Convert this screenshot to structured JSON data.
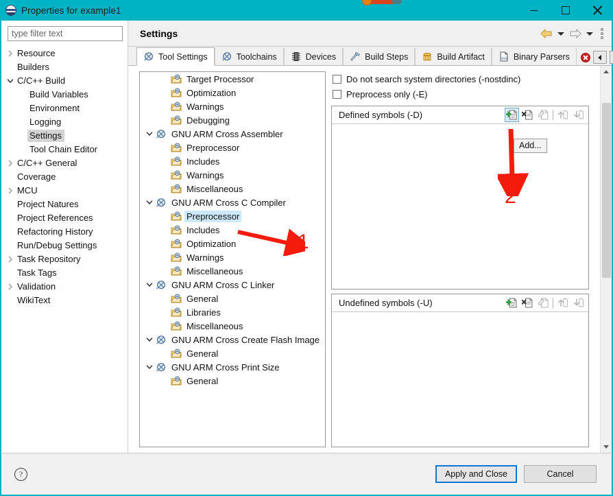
{
  "window": {
    "title": "Properties for example1",
    "app_icon": "eclipse-icon",
    "minimize_label": "Minimize",
    "maximize_label": "Maximize",
    "close_label": "Close"
  },
  "filter": {
    "placeholder": "type filter text",
    "value": ""
  },
  "sidebar": {
    "items": [
      {
        "label": "Resource",
        "indent": 0,
        "twisty": "collapsed",
        "selected": false
      },
      {
        "label": "Builders",
        "indent": 0,
        "twisty": "none",
        "selected": false
      },
      {
        "label": "C/C++ Build",
        "indent": 0,
        "twisty": "expanded",
        "selected": false
      },
      {
        "label": "Build Variables",
        "indent": 1,
        "twisty": "none",
        "selected": false
      },
      {
        "label": "Environment",
        "indent": 1,
        "twisty": "none",
        "selected": false
      },
      {
        "label": "Logging",
        "indent": 1,
        "twisty": "none",
        "selected": false
      },
      {
        "label": "Settings",
        "indent": 1,
        "twisty": "none",
        "selected": true
      },
      {
        "label": "Tool Chain Editor",
        "indent": 1,
        "twisty": "none",
        "selected": false
      },
      {
        "label": "C/C++ General",
        "indent": 0,
        "twisty": "collapsed",
        "selected": false
      },
      {
        "label": "Coverage",
        "indent": 0,
        "twisty": "none",
        "selected": false
      },
      {
        "label": "MCU",
        "indent": 0,
        "twisty": "collapsed",
        "selected": false
      },
      {
        "label": "Project Natures",
        "indent": 0,
        "twisty": "none",
        "selected": false
      },
      {
        "label": "Project References",
        "indent": 0,
        "twisty": "none",
        "selected": false
      },
      {
        "label": "Refactoring History",
        "indent": 0,
        "twisty": "none",
        "selected": false
      },
      {
        "label": "Run/Debug Settings",
        "indent": 0,
        "twisty": "none",
        "selected": false
      },
      {
        "label": "Task Repository",
        "indent": 0,
        "twisty": "collapsed",
        "selected": false
      },
      {
        "label": "Task Tags",
        "indent": 0,
        "twisty": "none",
        "selected": false
      },
      {
        "label": "Validation",
        "indent": 0,
        "twisty": "collapsed",
        "selected": false
      },
      {
        "label": "WikiText",
        "indent": 0,
        "twisty": "none",
        "selected": false
      }
    ]
  },
  "page": {
    "title": "Settings",
    "nav_back": "back-arrow-icon",
    "nav_back_menu": "back-dropdown-icon",
    "nav_forward": "forward-arrow-icon",
    "nav_forward_menu": "forward-dropdown-icon",
    "view_menu": "view-menu-icon"
  },
  "tabs": [
    {
      "label": "Tool Settings",
      "icon": "wrench-icon",
      "active": true
    },
    {
      "label": "Toolchains",
      "icon": "wrench-icon",
      "active": false
    },
    {
      "label": "Devices",
      "icon": "chip-icon",
      "active": false
    },
    {
      "label": "Build Steps",
      "icon": "hammer-icon",
      "active": false
    },
    {
      "label": "Build Artifact",
      "icon": "artifact-icon",
      "active": false
    },
    {
      "label": "Binary Parsers",
      "icon": "binary-file-icon",
      "active": false
    }
  ],
  "tab_overflow": {
    "error_badge": "error-icon",
    "prev_label": "scroll-tabs-left",
    "next_label": "scroll-tabs-right"
  },
  "tool_tree": [
    {
      "label": "Target Processor",
      "indent": 1,
      "twisty": "none",
      "icon": "tool-option-icon",
      "selected": false
    },
    {
      "label": "Optimization",
      "indent": 1,
      "twisty": "none",
      "icon": "tool-option-icon",
      "selected": false
    },
    {
      "label": "Warnings",
      "indent": 1,
      "twisty": "none",
      "icon": "tool-option-icon",
      "selected": false
    },
    {
      "label": "Debugging",
      "indent": 1,
      "twisty": "none",
      "icon": "tool-option-icon",
      "selected": false
    },
    {
      "label": "GNU ARM Cross Assembler",
      "indent": 0,
      "twisty": "expanded",
      "icon": "tool-icon",
      "selected": false
    },
    {
      "label": "Preprocessor",
      "indent": 1,
      "twisty": "none",
      "icon": "tool-option-icon",
      "selected": false
    },
    {
      "label": "Includes",
      "indent": 1,
      "twisty": "none",
      "icon": "tool-option-icon",
      "selected": false
    },
    {
      "label": "Warnings",
      "indent": 1,
      "twisty": "none",
      "icon": "tool-option-icon",
      "selected": false
    },
    {
      "label": "Miscellaneous",
      "indent": 1,
      "twisty": "none",
      "icon": "tool-option-icon",
      "selected": false
    },
    {
      "label": "GNU ARM Cross C Compiler",
      "indent": 0,
      "twisty": "expanded",
      "icon": "tool-icon",
      "selected": false
    },
    {
      "label": "Preprocessor",
      "indent": 1,
      "twisty": "none",
      "icon": "tool-option-icon",
      "selected": true
    },
    {
      "label": "Includes",
      "indent": 1,
      "twisty": "none",
      "icon": "tool-option-icon",
      "selected": false
    },
    {
      "label": "Optimization",
      "indent": 1,
      "twisty": "none",
      "icon": "tool-option-icon",
      "selected": false
    },
    {
      "label": "Warnings",
      "indent": 1,
      "twisty": "none",
      "icon": "tool-option-icon",
      "selected": false
    },
    {
      "label": "Miscellaneous",
      "indent": 1,
      "twisty": "none",
      "icon": "tool-option-icon",
      "selected": false
    },
    {
      "label": "GNU ARM Cross C Linker",
      "indent": 0,
      "twisty": "expanded",
      "icon": "tool-icon",
      "selected": false
    },
    {
      "label": "General",
      "indent": 1,
      "twisty": "none",
      "icon": "tool-option-icon",
      "selected": false
    },
    {
      "label": "Libraries",
      "indent": 1,
      "twisty": "none",
      "icon": "tool-option-icon",
      "selected": false
    },
    {
      "label": "Miscellaneous",
      "indent": 1,
      "twisty": "none",
      "icon": "tool-option-icon",
      "selected": false
    },
    {
      "label": "GNU ARM Cross Create Flash Image",
      "indent": 0,
      "twisty": "expanded",
      "icon": "tool-icon",
      "selected": false
    },
    {
      "label": "General",
      "indent": 1,
      "twisty": "none",
      "icon": "tool-option-icon",
      "selected": false
    },
    {
      "label": "GNU ARM Cross Print Size",
      "indent": 0,
      "twisty": "expanded",
      "icon": "tool-icon",
      "selected": false
    },
    {
      "label": "General",
      "indent": 1,
      "twisty": "none",
      "icon": "tool-option-icon",
      "selected": false
    }
  ],
  "options": {
    "checkboxes": [
      {
        "label": "Do not search system directories (-nostdinc)",
        "checked": false
      },
      {
        "label": "Preprocess only (-E)",
        "checked": false
      }
    ],
    "defined_symbols": {
      "title": "Defined symbols (-D)",
      "entries": [],
      "tools": [
        {
          "name": "add-icon",
          "label": "Add",
          "highlighted": true,
          "enabled": true
        },
        {
          "name": "delete-icon",
          "label": "Delete",
          "highlighted": false,
          "enabled": true
        },
        {
          "name": "edit-icon",
          "label": "Edit",
          "highlighted": false,
          "enabled": false
        },
        {
          "name": "move-up-icon",
          "label": "Move up",
          "highlighted": false,
          "enabled": false
        },
        {
          "name": "move-down-icon",
          "label": "Move down",
          "highlighted": false,
          "enabled": false
        }
      ]
    },
    "undefined_symbols": {
      "title": "Undefined symbols (-U)",
      "entries": [],
      "tools": [
        {
          "name": "add-icon",
          "label": "Add",
          "highlighted": false,
          "enabled": true
        },
        {
          "name": "delete-icon",
          "label": "Delete",
          "highlighted": false,
          "enabled": true
        },
        {
          "name": "edit-icon",
          "label": "Edit",
          "highlighted": false,
          "enabled": false
        },
        {
          "name": "move-up-icon",
          "label": "Move up",
          "highlighted": false,
          "enabled": false
        },
        {
          "name": "move-down-icon",
          "label": "Move down",
          "highlighted": false,
          "enabled": false
        }
      ]
    }
  },
  "tooltip": {
    "text": "Add..."
  },
  "annotations": [
    {
      "id": "1",
      "label": "1",
      "color": "#f41b0d",
      "points_to": "tool-tree-item-preprocessor"
    },
    {
      "id": "2",
      "label": "2",
      "color": "#f41b0d",
      "points_to": "defined-symbols-add-button"
    }
  ],
  "footer": {
    "help_label": "?",
    "apply_label": "Apply and Close",
    "cancel_label": "Cancel"
  },
  "colors": {
    "title_bar": "#00b3c4",
    "accent_focus": "#0a78d4",
    "selection": "#cde8f7",
    "sidebar_selection": "#d4d4d4",
    "annotation_red": "#f41b0d"
  }
}
